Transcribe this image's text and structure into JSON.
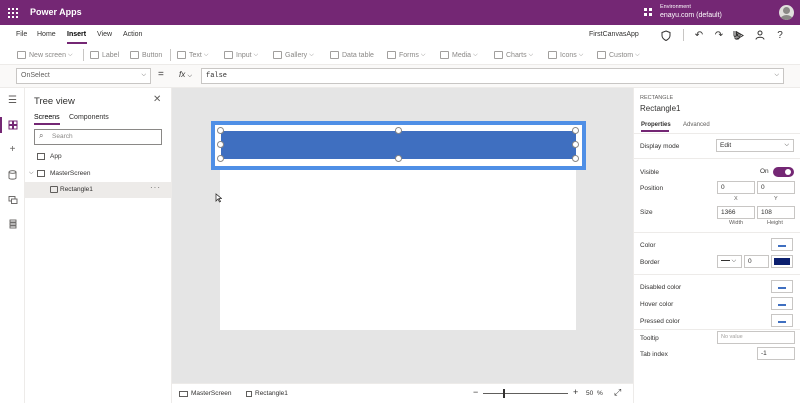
{
  "titlebar": {
    "app_name": "Power Apps",
    "environment_label": "Environment",
    "environment_value": "enayu.com (default)",
    "bg_color": "#742774"
  },
  "menu": {
    "items": [
      "File",
      "Home",
      "Insert",
      "View",
      "Action"
    ],
    "active": "Insert",
    "app_title": "FirstCanvasApp"
  },
  "toolbar": {
    "new_screen": "New screen",
    "label": "Label",
    "button": "Button",
    "text": "Text",
    "input": "Input",
    "gallery": "Gallery",
    "data_table": "Data table",
    "forms": "Forms",
    "media": "Media",
    "charts": "Charts",
    "icons": "Icons",
    "custom": "Custom"
  },
  "formula": {
    "property": "OnSelect",
    "equals": "=",
    "fx": "fx",
    "value": "false"
  },
  "tree": {
    "title": "Tree view",
    "tabs": [
      "Screens",
      "Components"
    ],
    "search_placeholder": "Search",
    "items": [
      {
        "label": "App",
        "level": 0
      },
      {
        "label": "MasterScreen",
        "level": 0,
        "expanded": true
      },
      {
        "label": "Rectangle1",
        "level": 1,
        "selected": true
      }
    ]
  },
  "canvas": {
    "rectangle_color": "#3f6fc0",
    "selection_color": "#4f8fe6"
  },
  "statusbar": {
    "screen_tab": "MasterScreen",
    "control_tab": "Rectangle1",
    "zoom_value": "50",
    "zoom_unit": "%"
  },
  "properties": {
    "control_type": "RECTANGLE",
    "control_name": "Rectangle1",
    "tabs": [
      "Properties",
      "Advanced"
    ],
    "display_mode_label": "Display mode",
    "display_mode_value": "Edit",
    "visible_label": "Visible",
    "visible_value": "On",
    "position_label": "Position",
    "position_x": "0",
    "position_y": "0",
    "x_label": "X",
    "y_label": "Y",
    "size_label": "Size",
    "width": "1366",
    "height": "108",
    "width_label": "Width",
    "height_label": "Height",
    "color_label": "Color",
    "border_label": "Border",
    "border_width": "0",
    "border_color": "#0b1f6e",
    "disabled_color_label": "Disabled color",
    "hover_color_label": "Hover color",
    "pressed_color_label": "Pressed color",
    "tooltip_label": "Tooltip",
    "tooltip_placeholder": "No value",
    "tab_index_label": "Tab index",
    "tab_index_value": "-1"
  }
}
